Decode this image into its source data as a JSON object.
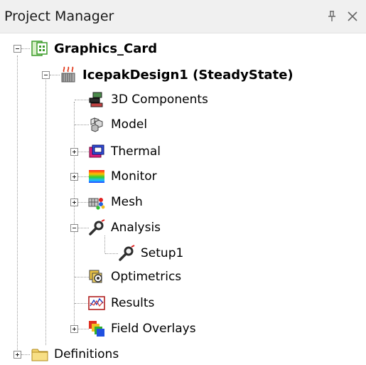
{
  "panel": {
    "title": "Project Manager",
    "pin_icon": "pin-icon",
    "close_icon": "close-icon"
  },
  "tree": {
    "project": {
      "label": "Graphics_Card",
      "icon": "project-icon",
      "expanded": true
    },
    "design": {
      "label": "IcepakDesign1 (SteadyState)",
      "icon": "icepak-design-icon",
      "expanded": true
    },
    "items": [
      {
        "label": "3D Components",
        "icon": "3d-components-icon",
        "expander": "none"
      },
      {
        "label": "Model",
        "icon": "model-icon",
        "expander": "none"
      },
      {
        "label": "Thermal",
        "icon": "thermal-icon",
        "expander": "plus"
      },
      {
        "label": "Monitor",
        "icon": "monitor-icon",
        "expander": "plus"
      },
      {
        "label": "Mesh",
        "icon": "mesh-icon",
        "expander": "plus"
      },
      {
        "label": "Analysis",
        "icon": "analysis-icon",
        "expander": "minus"
      },
      {
        "label": "Setup1",
        "icon": "setup-icon",
        "expander": "none",
        "child_of": "Analysis"
      },
      {
        "label": "Optimetrics",
        "icon": "optimetrics-icon",
        "expander": "none"
      },
      {
        "label": "Results",
        "icon": "results-icon",
        "expander": "none"
      },
      {
        "label": "Field Overlays",
        "icon": "field-overlays-icon",
        "expander": "plus"
      }
    ],
    "definitions": {
      "label": "Definitions",
      "icon": "folder-icon",
      "expanded": false
    }
  }
}
